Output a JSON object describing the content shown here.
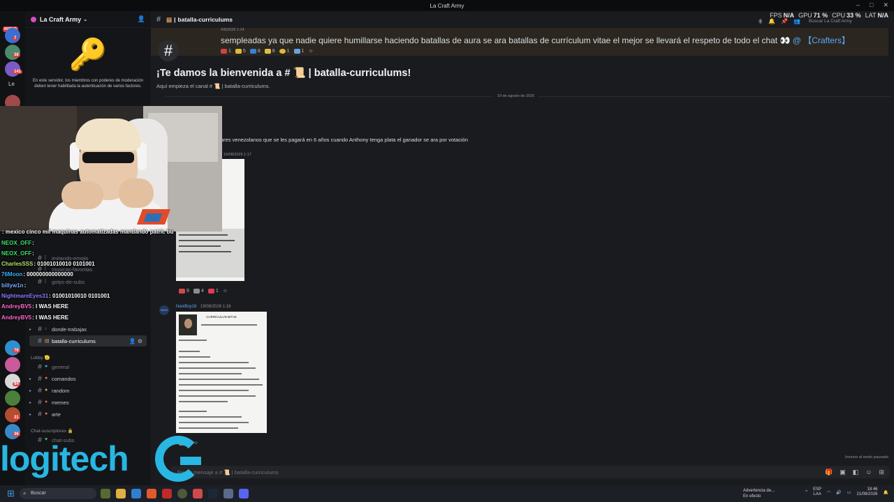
{
  "window": {
    "title": "La Craft Army"
  },
  "server": {
    "name": "La Craft Army",
    "new_badge": "NUEVO"
  },
  "rail": {
    "badges": [
      "7",
      "38",
      "141",
      "2",
      "76",
      "84",
      "31",
      "36"
    ],
    "label": "Le"
  },
  "security_notice": "En este servidor, los miembros con poderes de moderación deben tener habilitada la autenticación de varios factores.",
  "channels": {
    "top": [
      {
        "name": "imitando-emojis",
        "muted": true
      },
      {
        "name": "musicas-favoritas",
        "muted": true
      },
      {
        "name": "gotys-de-subs",
        "muted": true
      },
      {
        "name": "donde-trabajas",
        "muted": false
      },
      {
        "name": "batalla-curriculums",
        "muted": false,
        "active": true
      }
    ],
    "lobby_label": "Lobby",
    "lobby": [
      "general",
      "comandos",
      "random",
      "memes",
      "arte"
    ],
    "subs_label": "Chat-suscriptores",
    "subs": [
      "chat-subs"
    ]
  },
  "header": {
    "channel": "batalla-curriculums",
    "search_placeholder": "Buscar La Craft Army"
  },
  "perf": {
    "fps_label": "FPS",
    "fps": "N/A",
    "gpu_label": "GPU",
    "gpu": "71 %",
    "cpu_label": "CPU",
    "cpu": "33 %",
    "lat_label": "LAT",
    "lat": "N/A"
  },
  "welcome": {
    "title": "¡Te damos la bienvenida a # 📜 | batalla-curriculums!",
    "subtitle": "Aquí empieza el canal # 📜 | batalla-curriculums."
  },
  "date_divider": "19 de agosto de 2026",
  "messages": {
    "m1_time": "/06/2026 1:14",
    "m1_text": "sempleadas ya que nadie quiere humillarse haciendo batallas de aura se ara batallas de currículum vitae el mejor se llevará el respeto de todo el chat 👀",
    "m1_mention": "@ 【Crafters】",
    "m1_reactions": [
      "1",
      "5",
      "8",
      "8",
      "1",
      "1"
    ],
    "m2_text": "ares venezolanos que se les pagará en 6 años cuando Anthony tenga plata el ganador se ara por votación",
    "m2_time": "19/08/2026 1:17",
    "cv1_title": "ulo",
    "cv1_sub": "trabajo",
    "m2_reactions": [
      "9",
      "4",
      "1"
    ],
    "m3_author": "NaniBoy18",
    "m3_time": "19/08/2026 1:18",
    "m3_avatar": "NANI",
    "cv2_title": "CURRICULUN BITAE",
    "m3_reactions": [
      "4"
    ]
  },
  "composer": {
    "placeholder": "Enviar mensaje a # 📜 | batalla-curriculums",
    "slowmode": "Inmune al modo pausado"
  },
  "twitch_chat": [
    {
      "user": "",
      "text": ": mexico cinco mil maquinas automatizadas mandando patric bu",
      "color": "#d8d8d8"
    },
    {
      "user": "NEOX_OFF",
      "text": ":",
      "color": "#3fe06a"
    },
    {
      "user": "NEOX_OFF",
      "text": ":",
      "color": "#3fe06a"
    },
    {
      "user": "CharlesSSS",
      "text": ": 01001010010 0101001",
      "color": "#b0e36b"
    },
    {
      "user": "76Moon",
      "text": ": 000000000000000",
      "color": "#3ab2ff"
    },
    {
      "user": "billyw1n",
      "text": ":",
      "color": "#7aa8ff"
    },
    {
      "user": "NightmareEyes31",
      "text": ": 01001010010 0101001",
      "color": "#8a7dff"
    },
    {
      "user": "AndreyBV5",
      "text": ": I WAS HERE",
      "color": "#ff6bd0"
    },
    {
      "user": "AndreyBV5",
      "text": ": I WAS HERE",
      "color": "#ff6bd0"
    }
  ],
  "watermark": "logitech",
  "taskbar": {
    "search": "Buscar",
    "alert_line1": "Advertencia de...",
    "alert_line2": "En efecto",
    "lang1": "ESP",
    "lang2": "LAA",
    "time": "18:46",
    "date": "21/08/2026"
  }
}
